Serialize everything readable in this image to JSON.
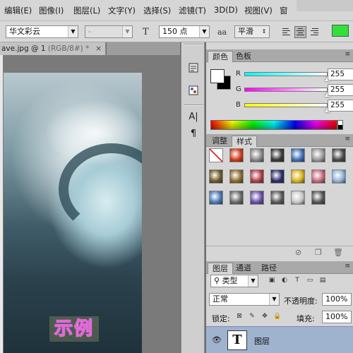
{
  "menubar": {
    "items": [
      "编辑(E)",
      "图像(I)",
      "图层(L)",
      "文字(Y)",
      "选择(S)",
      "滤镜(T)",
      "3D(D)",
      "视图(V)",
      "窗"
    ]
  },
  "options_bar": {
    "font_family": "华文彩云",
    "font_style": "-",
    "font_size": "150 点",
    "antialias_icon": "aa",
    "antialias": "平滑",
    "text_size_icon": "T",
    "align_selected": "center",
    "text_color": "#33e03a"
  },
  "document": {
    "tab_title": "ave.jpg @ 1",
    "tab_mode": "(RGB/8#) *",
    "close_glyph": "×",
    "sample_text": "示例"
  },
  "toolstrip": {
    "icons": [
      "history-icon",
      "pattern-icon",
      "character-icon",
      "paragraph-icon"
    ],
    "character_glyph": "A|",
    "paragraph_glyph": "¶"
  },
  "color_panel": {
    "tabs": [
      "颜色",
      "色板"
    ],
    "foreground": "#ffffff",
    "background": "#000000",
    "channels": [
      {
        "label": "R",
        "value": "255",
        "fraction": 1.0,
        "gradient": "linear-gradient(90deg,#00ffff,#ffffff)"
      },
      {
        "label": "G",
        "value": "255",
        "fraction": 1.0,
        "gradient": "linear-gradient(90deg,#ff00ff,#ffffff)"
      },
      {
        "label": "B",
        "value": "255",
        "fraction": 1.0,
        "gradient": "linear-gradient(90deg,#ffff00,#ffffff)"
      }
    ]
  },
  "styles_panel": {
    "tabs": [
      "调整",
      "样式"
    ],
    "swatches": [
      "#ffffff",
      "#d23a1a",
      "#8a8a8a",
      "#3a3a3a",
      "#3f6fb3",
      "#9a9a9a",
      "#4a4a4a",
      "#6e5a28",
      "#8b6a2e",
      "#b23a4a",
      "#2c2c6b",
      "#d7b319",
      "#c76a7a",
      "#8fb3d6",
      "#4a7ab7",
      "#6a6a6a",
      "#6a4fa8",
      "#5a5a5a",
      "#c8c8c8",
      "#555555"
    ]
  },
  "layers_panel": {
    "tabs": [
      "图层",
      "通道",
      "路径"
    ],
    "filter_label": "类型",
    "blend_mode": "正常",
    "opacity_label": "不透明度:",
    "opacity": "100%",
    "lock_label": "锁定:",
    "fill_label": "填充:",
    "fill": "100%",
    "layer": {
      "thumb_glyph": "T",
      "name": "图层",
      "visible": true
    }
  }
}
